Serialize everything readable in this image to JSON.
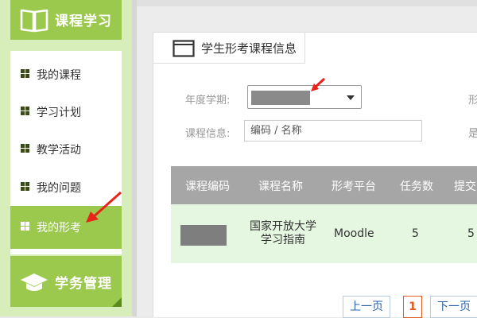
{
  "sidebar": {
    "section_title": "课程学习",
    "items": [
      {
        "label": "我的课程"
      },
      {
        "label": "学习计划"
      },
      {
        "label": "教学活动"
      },
      {
        "label": "我的问题"
      },
      {
        "label": "我的形考",
        "active": true
      }
    ],
    "footer_title": "学务管理"
  },
  "main": {
    "tab_title": "学生形考课程信息",
    "filters": {
      "term_label": "年度学期:",
      "course_label": "课程信息:",
      "course_placeholder": "编码 / 名称",
      "right_edge_1": "形",
      "right_edge_2": "是"
    },
    "table": {
      "headers": [
        "课程编码",
        "课程名称",
        "形考平台",
        "任务数",
        "提交"
      ],
      "rows": [
        {
          "name_line1": "国家开放大学",
          "name_line2": "学习指南",
          "platform": "Moodle",
          "tasks": "5",
          "submitted": "5"
        }
      ]
    },
    "pager": {
      "prev": "上一页",
      "current": "1",
      "next": "下一页"
    }
  },
  "colors": {
    "accent_green": "#9bc94d",
    "annotation_red": "#e8231a"
  }
}
